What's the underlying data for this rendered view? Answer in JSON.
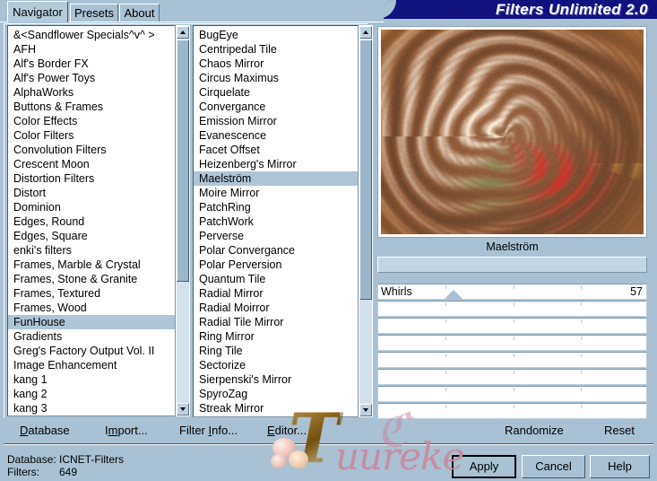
{
  "window": {
    "title": "Filters Unlimited 2.0"
  },
  "tabs": [
    {
      "label": "Navigator",
      "selected": true
    },
    {
      "label": "Presets",
      "selected": false
    },
    {
      "label": "About",
      "selected": false
    }
  ],
  "categories": {
    "selected": "FunHouse",
    "items": [
      "&<Sandflower Specials^v^ >",
      "AFH",
      "Alf's Border FX",
      "Alf's Power Toys",
      "AlphaWorks",
      "Buttons & Frames",
      "Color Effects",
      "Color Filters",
      "Convolution Filters",
      "Crescent Moon",
      "Distortion Filters",
      "Distort",
      "Dominion",
      "Edges, Round",
      "Edges, Square",
      "enki's filters",
      "Frames, Marble & Crystal",
      "Frames, Stone & Granite",
      "Frames, Textured",
      "Frames, Wood",
      "FunHouse",
      "Gradients",
      "Greg's Factory Output Vol. II",
      "Image Enhancement",
      "kang 1",
      "kang 2",
      "kang 3"
    ]
  },
  "filters": {
    "selected": "Maelström",
    "items": [
      "BugEye",
      "Centripedal Tile",
      "Chaos Mirror",
      "Circus Maximus",
      "Cirquelate",
      "Convergance",
      "Emission Mirror",
      "Evanescence",
      "Facet Offset",
      "Heizenberg's Mirror",
      "Maelström",
      "Moire Mirror",
      "PatchRing",
      "PatchWork",
      "Perverse",
      "Polar Convergance",
      "Polar Perversion",
      "Quantum Tile",
      "Radial Mirror",
      "Radial Moirror",
      "Radial Tile Mirror",
      "Ring Mirror",
      "Ring Tile",
      "Sectorize",
      "Sierpenski's Mirror",
      "SpyroZag",
      "Streak Mirror"
    ]
  },
  "preview": {
    "filter_name": "Maelström",
    "image_description": "brown sepia maelstrom swirl"
  },
  "sliders": [
    {
      "name": "Whirls",
      "value": "57",
      "percent": 28
    },
    {
      "name": "",
      "value": ""
    },
    {
      "name": "",
      "value": ""
    },
    {
      "name": "",
      "value": ""
    },
    {
      "name": "",
      "value": ""
    },
    {
      "name": "",
      "value": ""
    },
    {
      "name": "",
      "value": ""
    },
    {
      "name": "",
      "value": ""
    }
  ],
  "menu": {
    "database": "Database",
    "import": "Import...",
    "filter_info": "Filter Info...",
    "editor": "Editor...",
    "randomize": "Randomize",
    "reset": "Reset"
  },
  "status": {
    "database_label": "Database:",
    "database_value": "ICNET-Filters",
    "filters_label": "Filters:",
    "filters_value": "649"
  },
  "buttons": {
    "apply": "Apply",
    "cancel": "Cancel",
    "help": "Help"
  },
  "watermark": {
    "initial": "T",
    "text": "uureke"
  },
  "colors": {
    "background": "#a9c1d2",
    "titlebar": "#111180",
    "selection": "#afc5d6",
    "listbox": "#ffffff"
  }
}
